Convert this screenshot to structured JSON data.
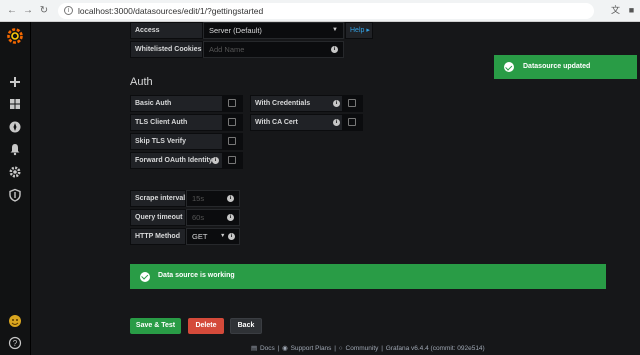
{
  "browser": {
    "url": "localhost:3000/datasources/edit/1/?gettingstarted"
  },
  "access": {
    "label": "Access",
    "value": "Server (Default)",
    "help_label": "Help",
    "help_chevron": "▸"
  },
  "whitelisted_cookies": {
    "label": "Whitelisted Cookies",
    "placeholder": "Add Name"
  },
  "auth": {
    "title": "Auth",
    "basic_auth": "Basic Auth",
    "with_credentials": "With Credentials",
    "tls_client_auth": "TLS Client Auth",
    "with_ca_cert": "With CA Cert",
    "skip_tls_verify": "Skip TLS Verify",
    "forward_oauth": "Forward OAuth Identity"
  },
  "settings": {
    "scrape_interval_label": "Scrape interval",
    "scrape_interval_placeholder": "15s",
    "query_timeout_label": "Query timeout",
    "query_timeout_placeholder": "60s",
    "http_method_label": "HTTP Method",
    "http_method_value": "GET"
  },
  "toast": {
    "text": "Datasource updated",
    "color": "#299c46"
  },
  "status": {
    "text": "Data source is working",
    "color": "#299c46"
  },
  "actions": {
    "save_test": "Save & Test",
    "delete": "Delete",
    "back": "Back",
    "save_color": "#299c46",
    "delete_color": "#d44a3a"
  },
  "footer": {
    "docs": "Docs",
    "support": "Support Plans",
    "community": "Community",
    "version": "Grafana v6.4.4 (commit: 092e514)",
    "sep": "|"
  }
}
